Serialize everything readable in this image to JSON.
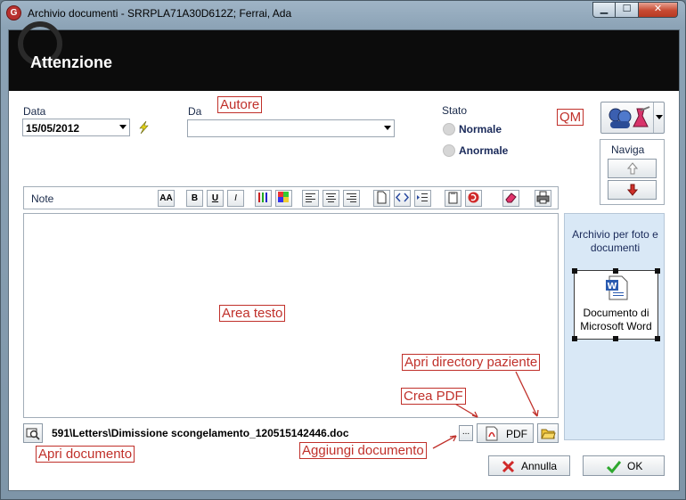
{
  "window": {
    "title": "Archivio documenti - SRRPLA71A30D612Z; Ferrai, Ada",
    "controls": {
      "minimize": "▁",
      "maximize": "☐",
      "close": "✕"
    }
  },
  "header": {
    "title": "Attenzione"
  },
  "form": {
    "data_label": "Data",
    "data_value": "15/05/2012",
    "da_label": "Da",
    "da_value": "",
    "stato_label": "Stato",
    "stato_options": [
      "Normale",
      "Anormale"
    ]
  },
  "naviga": {
    "label": "Naviga"
  },
  "toolbar": {
    "note_label": "Note",
    "icons": [
      "font-size-icon",
      "bold-icon",
      "underline-icon",
      "italic-icon",
      "pens-icon",
      "color-palette-icon",
      "align-left-icon",
      "align-center-icon",
      "align-right-icon",
      "new-doc-icon",
      "code-icon",
      "indent-icon",
      "clipboard-icon",
      "undo-icon",
      "eraser-icon",
      "print-icon"
    ],
    "bold": "B",
    "underline": "U",
    "italic": "I"
  },
  "side_panel": {
    "title": "Archivio per foto e documenti",
    "doc_tile_label": "Documento di Microsoft Word"
  },
  "bottom": {
    "path": "591\\Letters\\Dimissione scongelamento_120515142446.doc",
    "browse_label": "...",
    "pdf_label": "PDF"
  },
  "actions": {
    "cancel": "Annulla",
    "ok": "OK"
  },
  "annotations": {
    "autore": "Autore",
    "qm": "QM",
    "area_testo": "Area testo",
    "apri_directory": "Apri directory paziente",
    "crea_pdf": "Crea PDF",
    "apri_documento": "Apri documento",
    "aggiungi_documento": "Aggiungi documento"
  },
  "colors": {
    "header_bg": "#0c0c0c",
    "annotation": "#c0302a",
    "side_panel_bg": "#d9e8f6",
    "arrow_down": "#c0302a"
  }
}
